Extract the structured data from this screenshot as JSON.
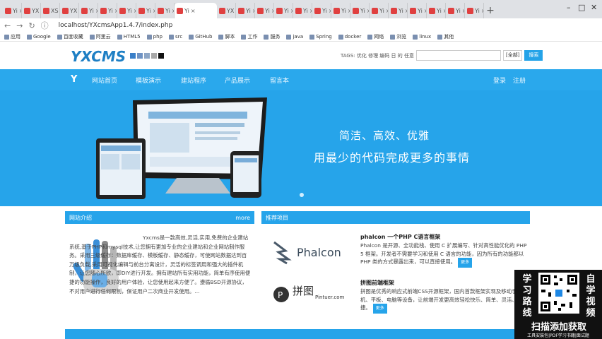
{
  "browser": {
    "tabs": [
      {
        "label": "Yi",
        "color": "#e04040"
      },
      {
        "label": "YX",
        "color": "#e04040"
      },
      {
        "label": "XS",
        "color": "#e04040"
      },
      {
        "label": "YX",
        "color": "#e04040"
      },
      {
        "label": "Yi",
        "color": "#e04040"
      },
      {
        "label": "Yi",
        "color": "#e04040"
      },
      {
        "label": "Yi",
        "color": "#e04040"
      },
      {
        "label": "Yi",
        "color": "#e04040"
      },
      {
        "label": "Yi",
        "color": "#e04040"
      },
      {
        "label": "Yi",
        "color": "#e04040"
      },
      {
        "label": "YX",
        "color": "#e04040"
      },
      {
        "label": "Yi",
        "color": "#e04040"
      },
      {
        "label": "Yi",
        "color": "#e04040"
      },
      {
        "label": "Yi",
        "color": "#e04040"
      },
      {
        "label": "Yi",
        "color": "#e04040"
      },
      {
        "label": "Yi",
        "color": "#e04040"
      },
      {
        "label": "Yi",
        "color": "#e04040"
      },
      {
        "label": "Yi",
        "color": "#e04040"
      },
      {
        "label": "Yi",
        "color": "#e04040"
      },
      {
        "label": "Yi",
        "color": "#e04040"
      },
      {
        "label": "Yi",
        "color": "#e04040"
      },
      {
        "label": "Yi",
        "color": "#e04040"
      },
      {
        "label": "Yi",
        "color": "#e04040"
      },
      {
        "label": "Yi",
        "color": "#e04040"
      }
    ],
    "active_tab": "YX",
    "url": "localhost/YXcmsApp1.4.7/index.php",
    "bookmarks": [
      "应用",
      "Google",
      "百度收藏",
      "阿里云",
      "HTML5",
      "php",
      "src",
      "GitHub",
      "脚本",
      "工作",
      "服务",
      "java",
      "Spring",
      "docker",
      "网络",
      "浏览",
      "linux",
      "其他"
    ]
  },
  "site": {
    "logo": "YXCMS",
    "logo_squares": [
      "#3a7fc8",
      "#6f93c4",
      "#8da6c6",
      "#a8a8a8",
      "#111111"
    ],
    "search_tags": "TAGS: 优化 修理 编码 日 的 任意",
    "search_scope": "[全部]",
    "search_button": "搜索",
    "nav": [
      "网站首页",
      "模板演示",
      "建站程序",
      "产品展示",
      "留言本"
    ],
    "nav_right": [
      "登录",
      "注册"
    ],
    "banner_line1": "简洁、高效、优雅",
    "banner_line2": "用最少的代码完成更多的事情"
  },
  "left_panel": {
    "title": "网站介绍",
    "more": "more",
    "text": "Yxcms是一款高效,灵活,实用,免费的企业建站系统,基于PHP和mysql技术,让您拥有更加专业的企业建站和企业网站制作服务。采用三级缓存：数据库缓存、模板缓存、静态缓存，可使网站数据达到百万级负载,采用可视化编辑与前台分离设计，灵活的标签调用和强大的插件机制，让您随心所欲，即DIY进行开发。拥有建站所有实用功能，简单有序使用便捷的功能操作，良好的用户体验，让您使用起来方便了。遵循BSD开源协议，不对用户进行任何限制，保证用户二次商业开发使用。..."
  },
  "right_panel": {
    "title": "推荐项目",
    "projects": [
      {
        "logo": "Phalcon",
        "title": "phalcon 一个PHP C语言框架",
        "desc": "Phalcon 是开源、全功能栈、使用 C 扩展编写、针对高性能优化的 PHP 5 框架。开发者不需要学习和使用 C 语言的功能，因为所有的功能都以 PHP 类的方式暴露出来，可以直接使用。",
        "more": "更多"
      },
      {
        "logo": "Pintuer.com",
        "title": "拼图前端框架",
        "desc": "拼图是优秀的响应式前端CSS开源框架，国内首款框架实现及移动手机、平板、电脑等设备，让前端开发更高效轻松快乐、简单、灵活、便捷。",
        "more": "更多"
      }
    ]
  },
  "ad": {
    "left": "学习路线",
    "right": "自学视频",
    "main": "扫描添加获取",
    "sub": "工具安装包|PDF学习书籍|面试题"
  }
}
